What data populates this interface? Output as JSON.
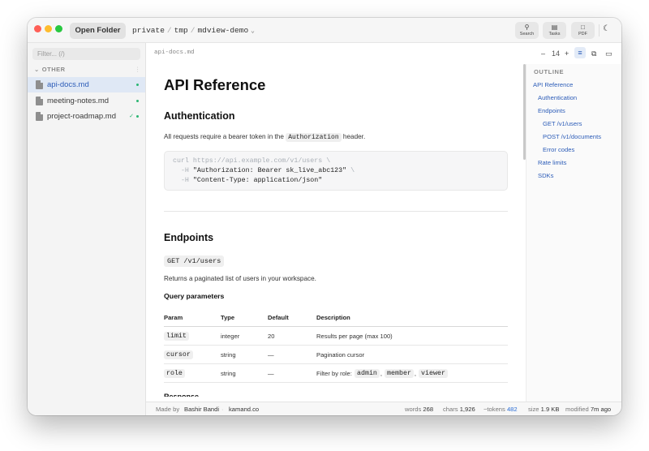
{
  "titlebar": {
    "open_folder_label": "Open Folder",
    "breadcrumb": [
      "private",
      "tmp",
      "mdview-demo"
    ],
    "separator": "/",
    "buttons": {
      "search": "Search",
      "tasks": "Tasks",
      "pdf": "PDF"
    }
  },
  "sidebar": {
    "filter_placeholder": "Filter... (/)",
    "group_label": "OTHER",
    "files": [
      {
        "name": "api-docs.md",
        "active": true
      },
      {
        "name": "meeting-notes.md",
        "active": false
      },
      {
        "name": "project-roadmap.md",
        "active": false,
        "check": "✓"
      }
    ]
  },
  "editor": {
    "file_path": "api-docs.md",
    "font_size": "14",
    "minus": "–",
    "plus": "+"
  },
  "doc": {
    "title": "API Reference",
    "auth_heading": "Authentication",
    "auth_text_before": "All requests require a bearer token in the",
    "auth_code": "Authorization",
    "auth_text_after": "header.",
    "code_line1": "curl https://api.example.com/v1/users \\",
    "code_line2_flag": "  -H ",
    "code_line2_value": "\"Authorization: Bearer sk_live_abc123\"",
    "code_line2_tail": " \\",
    "code_line3_flag": "  -H ",
    "code_line3_value": "\"Content-Type: application/json\"",
    "endpoints_heading": "Endpoints",
    "endpoint_code": "GET /v1/users",
    "endpoint_desc": "Returns a paginated list of users in your workspace.",
    "query_heading": "Query parameters",
    "table_headers": [
      "Param",
      "Type",
      "Default",
      "Description"
    ],
    "table_rows": [
      {
        "param": "limit",
        "type": "integer",
        "default": "20",
        "description": "Results per page (max 100)"
      },
      {
        "param": "cursor",
        "type": "string",
        "default": "—",
        "description": "Pagination cursor"
      },
      {
        "param": "role",
        "type": "string",
        "default": "—",
        "description": "Filter by role:"
      }
    ],
    "role_tags": [
      "admin",
      "member",
      "viewer"
    ],
    "next_heading": "Response"
  },
  "outline": {
    "heading": "OUTLINE",
    "items": [
      "API Reference",
      "Authentication",
      "Endpoints",
      "GET /v1/users",
      "POST /v1/documents",
      "Error codes",
      "Rate limits",
      "SDKs"
    ]
  },
  "statusbar": {
    "made_by": "Made by",
    "author": "Bashir Bandi",
    "site": "kamand.co",
    "words_label": "words",
    "words": "268",
    "chars_label": "chars",
    "chars": "1,926",
    "tokens_label": "~tokens",
    "tokens": "482",
    "size_label": "size",
    "size": "1.9 KB",
    "modified_label": "modified",
    "modified": "7m ago"
  },
  "colors": {
    "accent": "#2d5db8",
    "modified_dot": "#2bb673",
    "tokens": "#2d6fd6"
  }
}
